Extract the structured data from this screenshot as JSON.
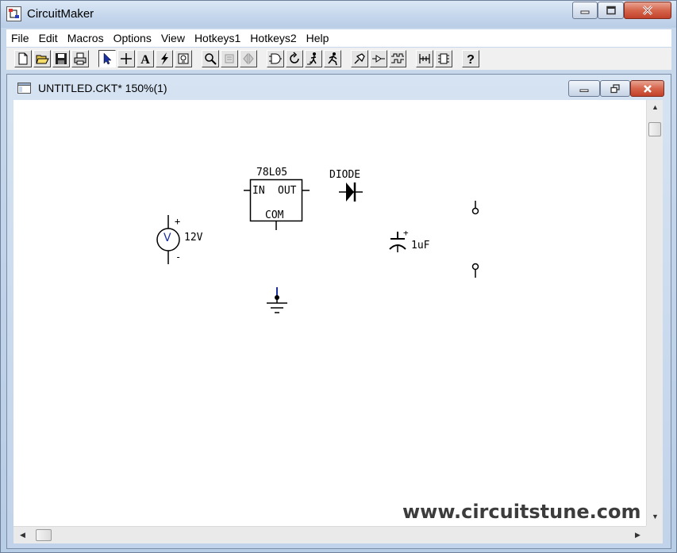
{
  "app": {
    "title": "CircuitMaker",
    "icon": "circuitmaker-app-icon"
  },
  "window_controls": {
    "minimize": "minimize-icon",
    "maximize": "maximize-icon",
    "close": "close-icon"
  },
  "menu": {
    "items": [
      "File",
      "Edit",
      "Macros",
      "Options",
      "View",
      "Hotkeys1",
      "Hotkeys2",
      "Help"
    ]
  },
  "toolbar": {
    "buttons": [
      "new-file-icon",
      "open-folder-icon",
      "save-icon",
      "print-icon",
      "arrow-pointer-icon",
      "wire-cross-icon",
      "text-icon",
      "probe-icon",
      "device-icon",
      "zoom-icon",
      "rotate-icon",
      "mirror-icon",
      "and-gate-icon",
      "reset-icon",
      "step-icon",
      "run-icon",
      "trace-icon",
      "waveform-icon",
      "logic-analyzer-icon",
      "bus-icon",
      "chip-icon",
      "help-icon"
    ]
  },
  "document": {
    "title": "UNTITLED.CKT* 150%(1)"
  },
  "schematic": {
    "regulator": {
      "name": "78L05",
      "in": "IN",
      "out": "OUT",
      "com": "COM"
    },
    "diode": {
      "label": "DIODE"
    },
    "source": {
      "symbol": "V",
      "value": "12V",
      "plus": "+",
      "minus": "-"
    },
    "capacitor": {
      "value": "1uF",
      "plus": "+"
    }
  },
  "watermark": "www.circuitstune.com",
  "colors": {
    "source_blue": "#1a2fa0",
    "ground_blue": "#1a2fa0",
    "close_red": "#c2412a"
  }
}
